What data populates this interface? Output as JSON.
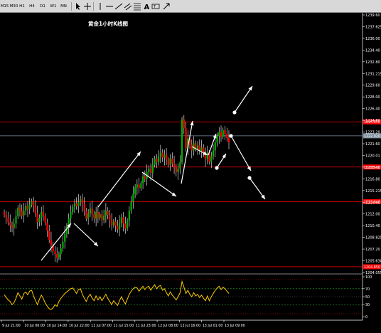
{
  "toolbar": {
    "timeframes": [
      "M15",
      "M30",
      "H1",
      "H4",
      "D1",
      "W1",
      "MN"
    ],
    "tools": [
      "cursor-icon",
      "crosshair-icon",
      "vertical-line-icon",
      "horizontal-line-icon",
      "trendline-icon",
      "channel-icon",
      "fibonacci-icon",
      "text-icon",
      "text-label-icon",
      "arrow-icon"
    ]
  },
  "main_chart": {
    "title": "黄金1小时K线图",
    "price_scale": [
      "1239.60",
      "1237.625",
      "1236.00",
      "1234.40",
      "1232.80",
      "1231.215",
      "1229.60",
      "1228.00",
      "1226.40",
      "1224.80",
      "1223.20",
      "1221.60",
      "1220.01",
      "1218.40",
      "1216.80",
      "1215.215",
      "1213.60",
      "1212.00",
      "1210.40",
      "1208.825",
      "1207.20",
      "1205.630",
      "1204.055"
    ],
    "level_lines": [
      {
        "price": "1224.850",
        "color": "#ff0000"
      },
      {
        "price": "1222.920",
        "color": "#7f8fa0"
      },
      {
        "price": "1218.610",
        "color": "#ff0000"
      },
      {
        "price": "1213.840",
        "color": "#ff0000"
      },
      {
        "price": "1204.850",
        "color": "#ff0000"
      }
    ]
  },
  "indicator": {
    "scale": [
      "100",
      "70",
      "50",
      "30",
      "0"
    ],
    "line_color": "#ffcc00"
  },
  "time_axis": [
    "9 Jul 21:00",
    "10 Jul 06:00",
    "10 Jul 14:00",
    "10 Jul 22:00",
    "11 Jul 07:00",
    "11 Jul 15:00",
    "11 Jul 23:00",
    "12 Jul 08:00",
    "12 Jul 16:00",
    "13 Jul 01:00",
    "13 Jul 09:00"
  ],
  "colors": {
    "bull": "#00b000",
    "bear": "#ff0000",
    "annotation": "#ffffff",
    "grid": "#ffffff"
  }
}
